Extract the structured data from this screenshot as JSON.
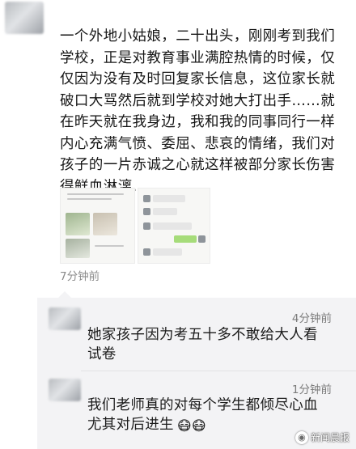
{
  "post": {
    "text": "一个外地小姑娘，二十出头，刚刚考到我们学校，正是对教育事业满腔热情的时候，仅仅因为没有及时回复家长信息，这位家长就破口大骂然后就到学校对她大打出手……就在昨天就在我身边，我和我的同事同行一样内心充满气愤、委屈、悲哀的情绪，我们对孩子的一片赤诚之心就这样被部分家长伤害得鲜血淋漓……",
    "time": "7分钟前"
  },
  "comments": [
    {
      "time": "4分钟前",
      "text": "她家孩子因为考五十多不敢给大人看试卷"
    },
    {
      "time": "1分钟前",
      "text": "我们老师真的对每个学生都倾尽心血尤其对后进生",
      "emoji": "😷😷"
    }
  ],
  "watermark": {
    "label": "新闻晨报",
    "icon": "newspaper-logo-icon"
  },
  "colors": {
    "comment_bg": "#f3f3f5",
    "time_gray": "#8a8a8a",
    "text": "#161616"
  }
}
